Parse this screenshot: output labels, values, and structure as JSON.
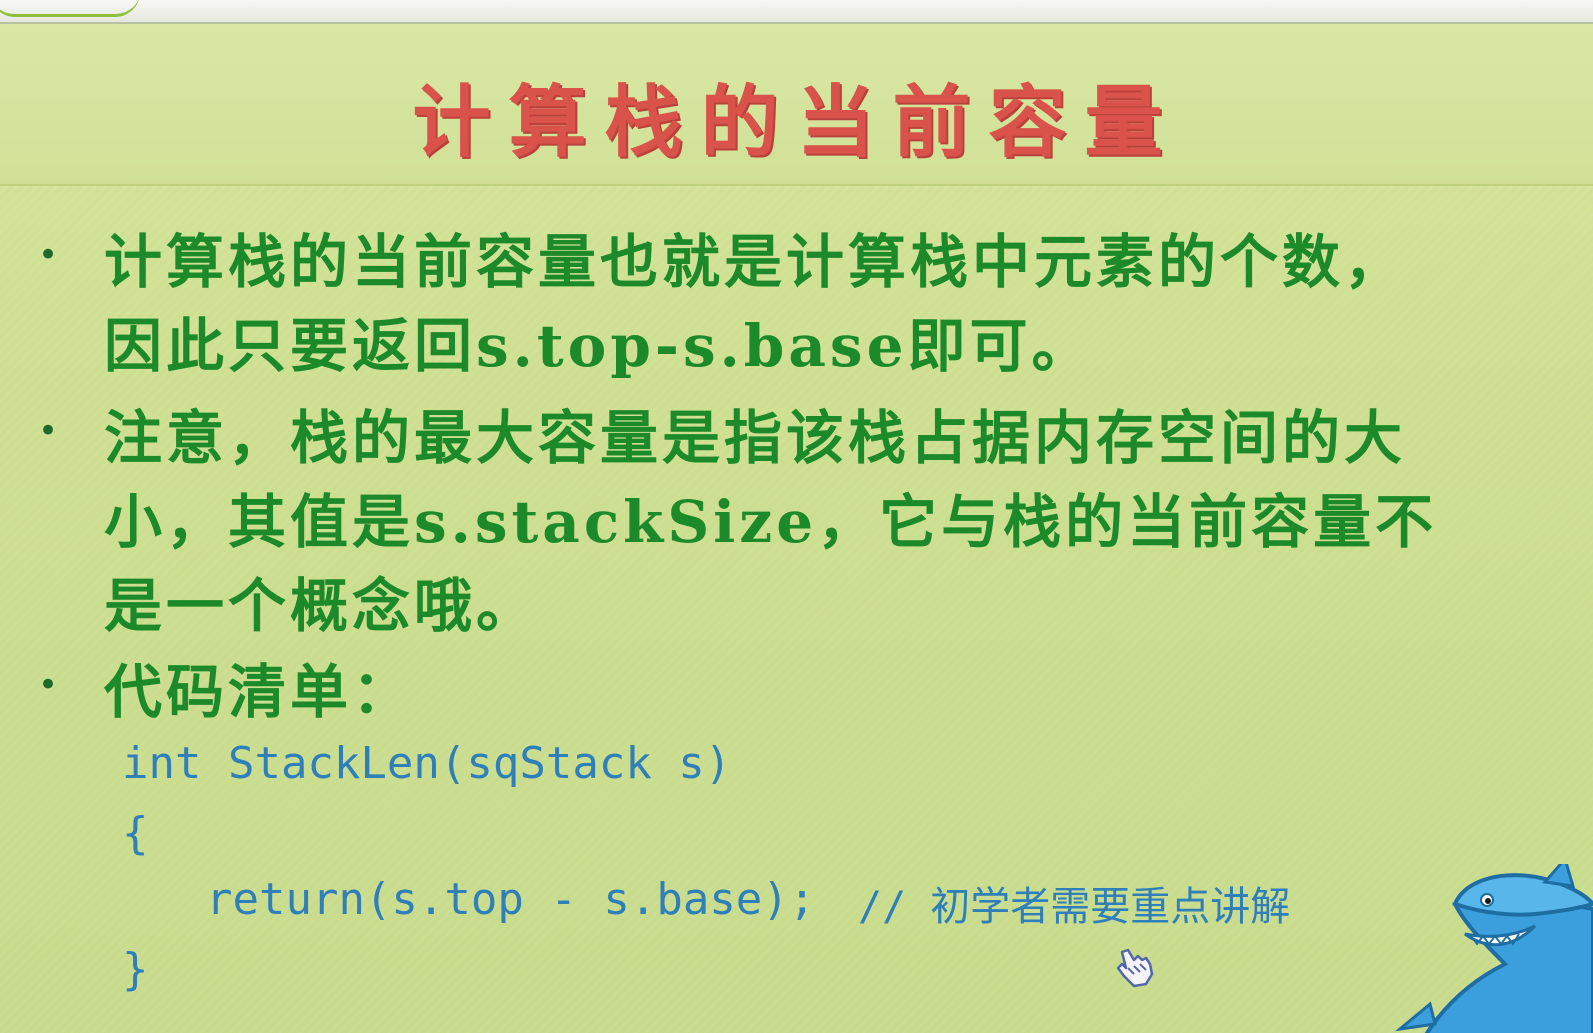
{
  "slide": {
    "title": "计算栈的当前容量",
    "bullets": [
      {
        "lines": [
          "计算栈的当前容量也就是计算栈中元素的个数，",
          "因此只要返回s.top-s.base即可。"
        ]
      },
      {
        "lines": [
          "注意，栈的最大容量是指该栈占据内存空间的大",
          "小，其值是s.stackSize，它与栈的当前容量不",
          "是一个概念哦。"
        ]
      },
      {
        "lines": [
          "代码清单："
        ]
      }
    ],
    "code": {
      "line1": "int StackLen(sqStack s)",
      "line2": "{",
      "line3": "return(s.top - s.base);",
      "comment": "// 初学者需要重点讲解",
      "line4": "}"
    }
  },
  "icons": {
    "cursor": "hand-pointer-icon",
    "mascot": "shark-mascot-icon"
  },
  "colors": {
    "title": "#d9534a",
    "body_text": "#1d8a2a",
    "code_text": "#2f7fb8",
    "background": "#cfe092"
  }
}
